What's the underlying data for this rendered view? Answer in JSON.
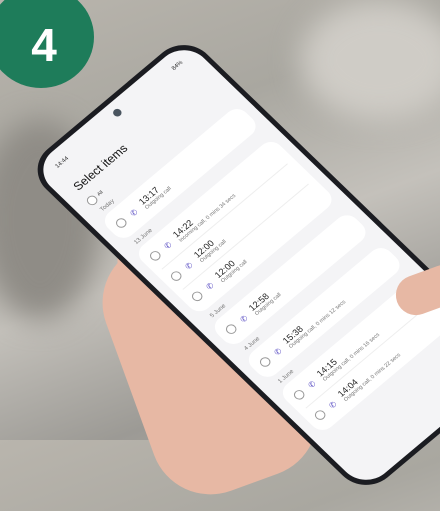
{
  "badge": {
    "number": "4",
    "color": "#1e7c5a"
  },
  "phone": {
    "status_time": "14:44",
    "status_battery": "84%",
    "title": "Select items",
    "all_label": "All",
    "groups": [
      {
        "date": "Today",
        "calls": [
          {
            "time": "13:17",
            "detail": "Outgoing call"
          }
        ]
      },
      {
        "date": "13 June",
        "calls": [
          {
            "time": "14:22",
            "detail": "Incoming call, 0 mins 34 secs"
          },
          {
            "time": "12:00",
            "detail": "Outgoing call"
          },
          {
            "time": "12:00",
            "detail": "Outgoing call"
          }
        ]
      },
      {
        "date": "5 June",
        "calls": [
          {
            "time": "12:58",
            "detail": "Outgoing call"
          }
        ]
      },
      {
        "date": "4 June",
        "calls": [
          {
            "time": "15:38",
            "detail": "Outgoing call, 0 mins 12 secs"
          }
        ]
      },
      {
        "date": "1 June",
        "calls": [
          {
            "time": "14:15",
            "detail": "Outgoing call, 0 mins 16 secs"
          },
          {
            "time": "14:04",
            "detail": "Outgoing call, 0 mins 22 secs"
          }
        ]
      }
    ],
    "call_icon": "phone-outgoing-icon"
  }
}
